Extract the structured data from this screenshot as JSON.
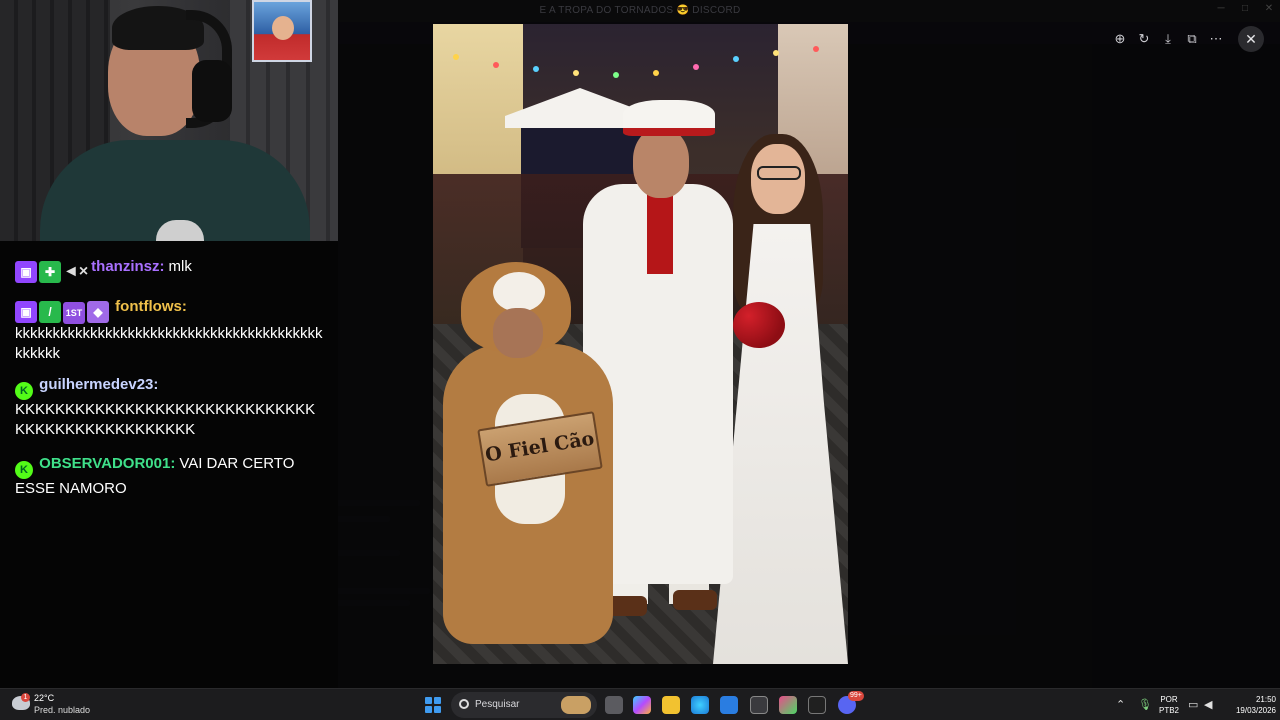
{
  "background_app": {
    "window_title": "E A TROPA DO TORNADOS 😎 DISCORD",
    "channel_title": "Tornados"
  },
  "chat": {
    "messages": [
      {
        "user": "thanzinsz:",
        "user_color": "#a970ff",
        "text": "mlk",
        "badges": [
          "twitch",
          "green-puzzle",
          "muted"
        ]
      },
      {
        "user": "fontflows:",
        "user_color": "#f0c14b",
        "text": "kkkkkkkkkkkkkkkkkkkkkkkkkkkkkkkkkkkkkkkkkkkkkkk",
        "badges": [
          "twitch",
          "green-sword",
          "first",
          "purple-diamond"
        ]
      },
      {
        "user": "guilhermedev23:",
        "user_color": "#c8d4ff",
        "text": "KKKKKKKKKKKKKKKKKKKKKKKKKKKKKKKKKKKKKKKKKKKKKKKK",
        "badges": [
          "kick"
        ]
      },
      {
        "user": "OBSERVADOR001:",
        "user_color": "#3fe08a",
        "text": "VAI DAR CERTO ESSE NAMORO",
        "badges": [
          "kick"
        ]
      }
    ],
    "badge_labels": {
      "first": "1ST",
      "kick": "K"
    }
  },
  "viewer": {
    "image_sign_text": "O Fiel Cão",
    "tools": [
      "zoom-in-icon",
      "rotate-icon",
      "download-icon",
      "open-external-icon",
      "more-icon"
    ],
    "close_label": "✕"
  },
  "taskbar": {
    "weather_temp": "22°C",
    "weather_text": "Pred. nublado",
    "weather_alert": "1",
    "search_placeholder": "Pesquisar",
    "discord_badge": "99+",
    "lang_top": "POR",
    "lang_bottom": "PTB2",
    "time": "21:50",
    "date": "19/03/2026"
  },
  "colors": {
    "accent": "#9146ff",
    "kick": "#53fc18",
    "windows_blue": "#3f9bf0"
  }
}
